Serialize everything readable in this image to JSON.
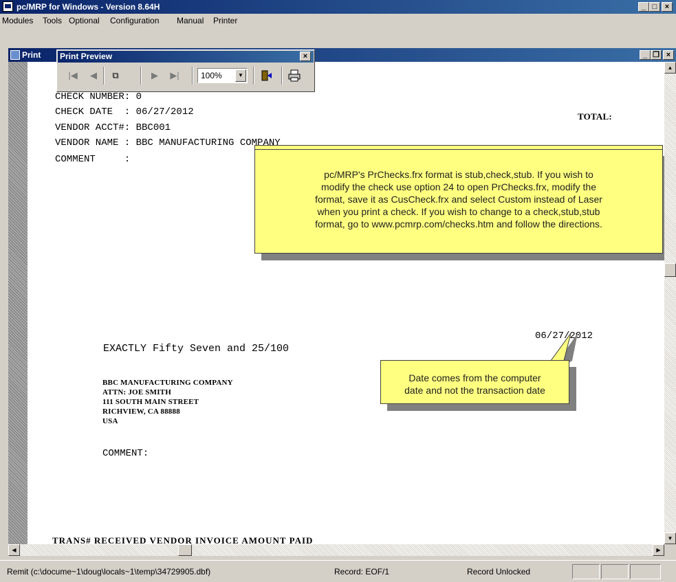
{
  "window": {
    "title": "pc/MRP for Windows - Version 8.64H",
    "minimize": "_",
    "maximize": "□",
    "close": "×"
  },
  "menu": [
    "Modules",
    "Tools",
    "Optional",
    "Configuration",
    "Manual",
    "Printer"
  ],
  "child_window": {
    "title": "Print",
    "minimize": "_",
    "restore": "❐",
    "close": "×"
  },
  "preview_toolbar": {
    "title": "Print Preview",
    "close": "×",
    "zoom": "100%",
    "first": "|◀",
    "prev": "◀",
    "next": "▶",
    "last": "▶|"
  },
  "report": {
    "header_lines": [
      "CHECK NUMBER: 0",
      "CHECK DATE  : 06/27/2012",
      "VENDOR ACCT#: BBC001",
      "VENDOR NAME : BBC MANUFACTURING COMPANY",
      "COMMENT     :"
    ],
    "total_label": "TOTAL:",
    "check_date": "06/27/2012",
    "amount_words": "EXACTLY Fifty Seven and 25/100",
    "address_lines": [
      "BBC MANUFACTURING COMPANY",
      "ATTN: JOE SMITH",
      "111 SOUTH MAIN STREET",
      "RICHVIEW, CA 88888",
      "USA"
    ],
    "comment_label": "COMMENT:",
    "bottom_header": "TRANS#  RECEIVED   VENDOR INVOICE       AMOUNT PAID"
  },
  "callouts": {
    "main": [
      "pc/MRP's PrChecks.frx format is stub,check,stub.  If you wish to",
      "modify the check use option 24 to open PrChecks.frx, modify the",
      "format, save it as CusCheck.frx and select Custom instead of Laser",
      "when you print a check.  If you wish to change to a check,stub,stub",
      "format, go to www.pcmrp.com/checks.htm and follow the directions."
    ],
    "date": [
      "Date comes from the computer",
      "date and not the transaction date"
    ]
  },
  "status": {
    "path": "Remit (c:\\docume~1\\doug\\locals~1\\temp\\34729905.dbf)",
    "record": "Record: EOF/1",
    "lock": "Record Unlocked"
  }
}
